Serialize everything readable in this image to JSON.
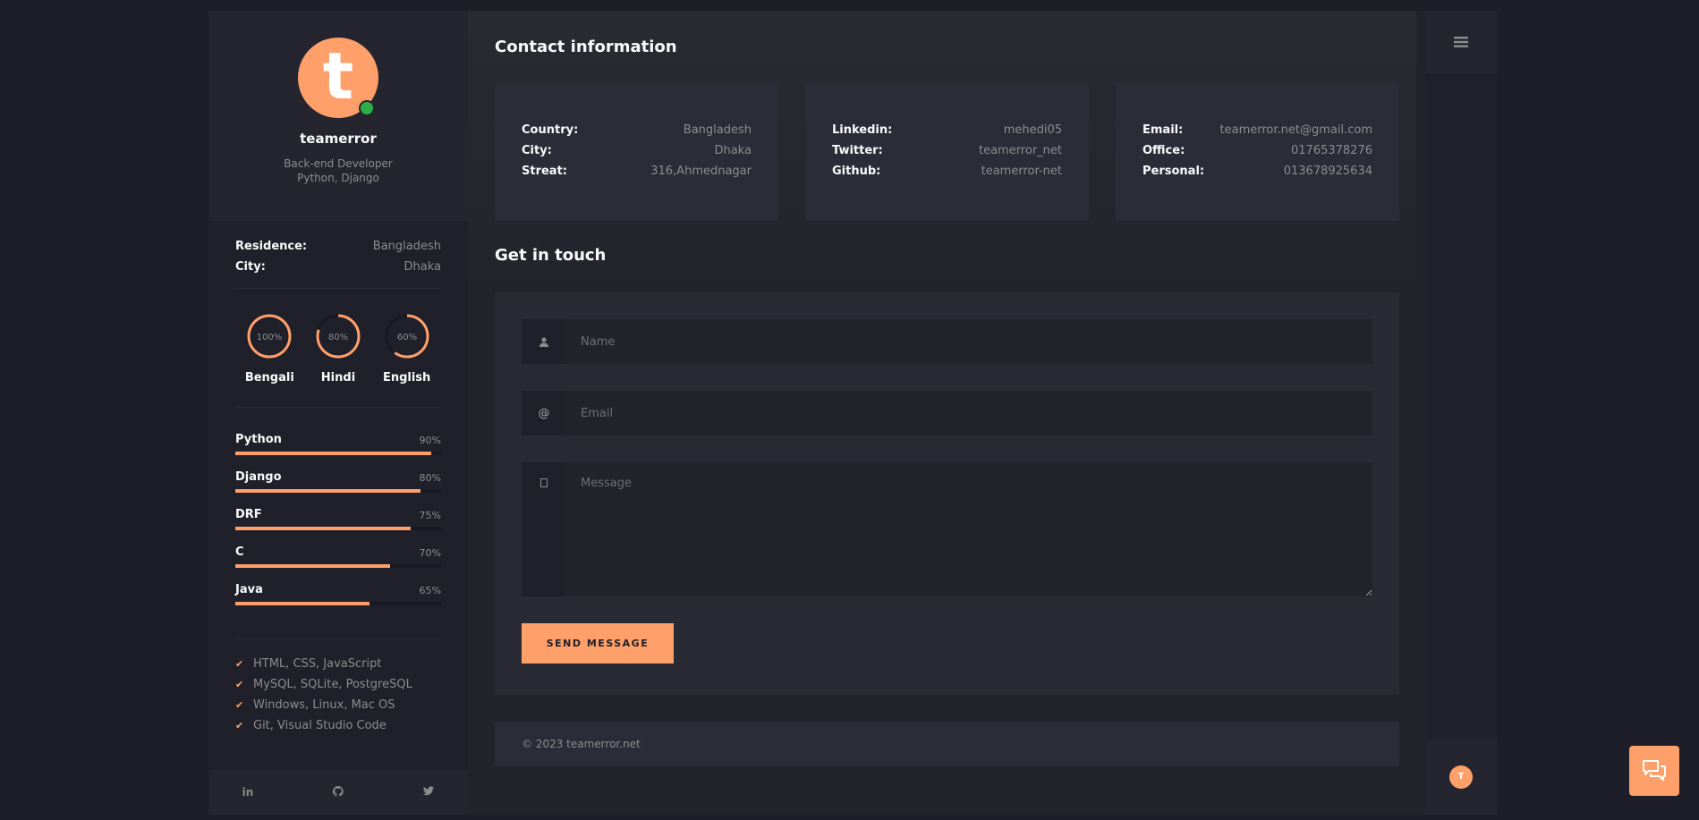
{
  "profile": {
    "avatar_letter": "t",
    "name": "teamerror",
    "role_line1": "Back-end Developer",
    "role_line2": "Python, Django"
  },
  "sidebar_info": [
    {
      "label": "Residence:",
      "value": "Bangladesh"
    },
    {
      "label": "City:",
      "value": "Dhaka"
    }
  ],
  "languages": [
    {
      "name": "Bengali",
      "percent_label": "100%",
      "percent": 100
    },
    {
      "name": "Hindi",
      "percent_label": "80%",
      "percent": 80
    },
    {
      "name": "English",
      "percent_label": "60%",
      "percent": 60
    }
  ],
  "skills": [
    {
      "name": "Python",
      "percent_label": "90%",
      "percent": 95
    },
    {
      "name": "Django",
      "percent_label": "80%",
      "percent": 90
    },
    {
      "name": "DRF",
      "percent_label": "75%",
      "percent": 85
    },
    {
      "name": "C",
      "percent_label": "70%",
      "percent": 75
    },
    {
      "name": "Java",
      "percent_label": "65%",
      "percent": 65
    }
  ],
  "knowledge": [
    "HTML, CSS, JavaScript",
    "MySQL, SQLite, PostgreSQL",
    "Windows, Linux, Mac OS",
    "Git, Visual Studio Code"
  ],
  "social": {
    "linkedin": "in",
    "github": "github-icon",
    "twitter": "twitter-icon"
  },
  "contact_title": "Contact information",
  "contact_cards": [
    [
      {
        "label": "Country:",
        "value": "Bangladesh"
      },
      {
        "label": "City:",
        "value": "Dhaka"
      },
      {
        "label": "Streat:",
        "value": "316,Ahmednagar"
      }
    ],
    [
      {
        "label": "Linkedin:",
        "value": "mehedi05"
      },
      {
        "label": "Twitter:",
        "value": "teamerror_net"
      },
      {
        "label": "Github:",
        "value": "teamerror-net"
      }
    ],
    [
      {
        "label": "Email:",
        "value": "teamerror.net@gmail.com"
      },
      {
        "label": "Office:",
        "value": "01765378276"
      },
      {
        "label": "Personal:",
        "value": "013678925634"
      }
    ]
  ],
  "get_in_touch_title": "Get in touch",
  "form": {
    "name_placeholder": "Name",
    "email_placeholder": "Email",
    "message_placeholder": "Message",
    "email_icon": "@",
    "send_label": "SEND MESSAGE"
  },
  "footer_text": "© 2023 teamerror.net",
  "rail_avatar_letter": "T",
  "colors": {
    "accent": "#ffa06a",
    "online": "#2eae48",
    "background": "#1e1e28"
  }
}
